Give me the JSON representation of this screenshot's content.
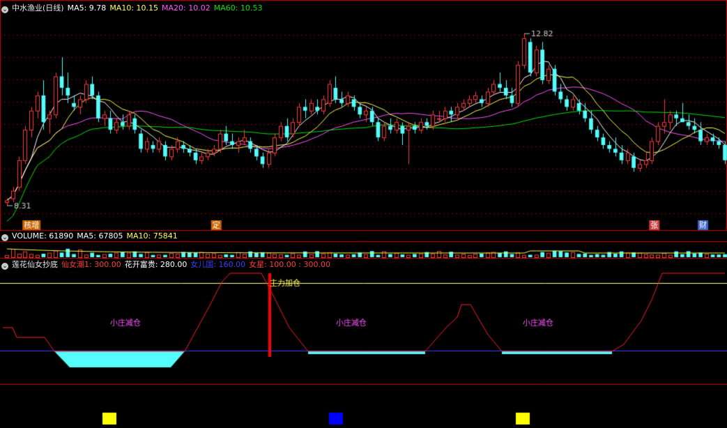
{
  "colors": {
    "up": "#ff3c3c",
    "down": "#54fcfc",
    "ma5": "#ffffff",
    "ma10": "#ffff54",
    "ma20": "#ff54ff",
    "ma60": "#00e600",
    "frame": "#c80000",
    "curve": "#ff2020",
    "blueline": "#3c3cff",
    "yellowline": "#ffffa0",
    "zone_label": "#ff54ff",
    "fill": "#54fcfc"
  },
  "price_panel": {
    "collapse_icon": "⌄",
    "stock_name": "中水渔业(日线)",
    "ma5": "MA5: 9.78",
    "ma10": "MA10: 10.15",
    "ma20": "MA20: 10.02",
    "ma60": "MA60: 10.53",
    "high_label": "12.82",
    "low_label": "8.31",
    "markers": [
      {
        "text": "核增",
        "bg": "#c86400",
        "index": 3
      },
      {
        "text": "定",
        "bg": "#c86400",
        "index": 34
      },
      {
        "text": "张",
        "bg": "#c83c3c",
        "index": 106
      },
      {
        "text": "财",
        "bg": "#3c64c8",
        "index": 114
      }
    ]
  },
  "volume_panel": {
    "collapse_icon": "⌄",
    "label": "VOLUME: 61890",
    "ma5": "MA5: 67805",
    "ma10": "MA10: 75841"
  },
  "indicator_panel": {
    "collapse_icon": "⌄",
    "name": "莲花仙女抄底",
    "v1": "仙女潮1: 300.00",
    "v2": "花开富贵: 280.00",
    "v3": "女儿国: 160.00",
    "v4": "女星: 100.00 : 300.00",
    "signal_label": "主力加仓",
    "zone_labels": [
      "小庄减仓",
      "小庄减仓",
      "小庄减仓"
    ],
    "squares": [
      "#ffff00",
      "#0000ff",
      "#ffff00"
    ]
  },
  "chart_data": {
    "type": "candlestick",
    "price_range": [
      8.0,
      13.3
    ],
    "candles": [
      [
        8.4,
        8.5,
        8.31,
        8.45
      ],
      [
        8.5,
        8.8,
        8.4,
        8.7
      ],
      [
        8.8,
        9.6,
        8.7,
        9.5
      ],
      [
        9.5,
        10.4,
        9.4,
        10.3
      ],
      [
        10.3,
        10.9,
        10.1,
        10.8
      ],
      [
        10.8,
        11.3,
        10.6,
        11.2
      ],
      [
        11.2,
        11.6,
        10.3,
        10.5
      ],
      [
        10.6,
        10.8,
        10.2,
        10.7
      ],
      [
        10.7,
        11.8,
        10.6,
        11.7
      ],
      [
        11.7,
        12.2,
        11.2,
        11.4
      ],
      [
        11.4,
        11.8,
        11.0,
        11.2
      ],
      [
        11.0,
        11.2,
        10.8,
        10.9
      ],
      [
        10.9,
        11.2,
        10.7,
        11.1
      ],
      [
        11.1,
        11.6,
        11.0,
        11.5
      ],
      [
        11.5,
        11.7,
        11.1,
        11.2
      ],
      [
        11.2,
        11.3,
        10.5,
        10.6
      ],
      [
        10.6,
        10.8,
        10.4,
        10.7
      ],
      [
        10.6,
        10.8,
        10.2,
        10.3
      ],
      [
        10.3,
        10.6,
        10.2,
        10.5
      ],
      [
        10.5,
        10.7,
        10.3,
        10.4
      ],
      [
        10.4,
        10.8,
        10.3,
        10.7
      ],
      [
        10.6,
        10.7,
        10.2,
        10.3
      ],
      [
        10.2,
        10.3,
        9.7,
        9.8
      ],
      [
        9.8,
        10.1,
        9.7,
        10.0
      ],
      [
        9.9,
        10.0,
        9.7,
        9.8
      ],
      [
        9.8,
        10.1,
        9.7,
        10.0
      ],
      [
        9.9,
        10.0,
        9.5,
        9.6
      ],
      [
        9.6,
        9.9,
        9.5,
        9.8
      ],
      [
        9.8,
        10.1,
        9.7,
        10.0
      ],
      [
        9.9,
        10.0,
        9.7,
        9.8
      ],
      [
        9.8,
        9.9,
        9.6,
        9.7
      ],
      [
        9.7,
        9.8,
        9.4,
        9.5
      ],
      [
        9.5,
        9.7,
        9.4,
        9.6
      ],
      [
        9.6,
        9.8,
        9.5,
        9.7
      ],
      [
        9.7,
        9.9,
        9.6,
        9.8
      ],
      [
        9.8,
        10.3,
        9.7,
        10.2
      ],
      [
        10.2,
        10.4,
        9.9,
        10.0
      ],
      [
        10.0,
        10.2,
        9.8,
        9.9
      ],
      [
        9.9,
        10.1,
        9.7,
        10.0
      ],
      [
        10.0,
        10.3,
        9.9,
        10.1
      ],
      [
        10.0,
        10.1,
        9.7,
        9.8
      ],
      [
        9.8,
        9.9,
        9.5,
        9.6
      ],
      [
        9.6,
        9.7,
        9.3,
        9.4
      ],
      [
        9.4,
        9.8,
        9.3,
        9.7
      ],
      [
        9.7,
        10.2,
        9.6,
        10.1
      ],
      [
        10.1,
        10.5,
        10.0,
        10.4
      ],
      [
        10.4,
        10.6,
        10.0,
        10.1
      ],
      [
        10.2,
        10.6,
        10.1,
        10.5
      ],
      [
        10.5,
        11.0,
        10.4,
        10.9
      ],
      [
        10.9,
        11.1,
        10.6,
        10.8
      ],
      [
        10.8,
        11.1,
        10.7,
        11.0
      ],
      [
        10.9,
        11.1,
        10.7,
        10.8
      ],
      [
        10.8,
        11.2,
        10.7,
        11.1
      ],
      [
        11.0,
        11.6,
        10.9,
        11.5
      ],
      [
        11.4,
        11.7,
        11.0,
        11.1
      ],
      [
        11.1,
        11.3,
        10.9,
        11.0
      ],
      [
        11.0,
        11.3,
        10.9,
        11.2
      ],
      [
        11.1,
        11.2,
        10.8,
        10.9
      ],
      [
        10.9,
        11.0,
        10.6,
        10.7
      ],
      [
        10.7,
        10.9,
        10.5,
        10.8
      ],
      [
        10.8,
        10.9,
        10.4,
        10.5
      ],
      [
        10.5,
        10.6,
        10.0,
        10.1
      ],
      [
        10.1,
        10.5,
        10.0,
        10.4
      ],
      [
        10.4,
        10.6,
        10.2,
        10.3
      ],
      [
        10.3,
        10.6,
        10.2,
        10.5
      ],
      [
        10.4,
        10.5,
        9.9,
        10.2
      ],
      [
        10.3,
        10.5,
        9.4,
        10.4
      ],
      [
        10.4,
        10.5,
        10.2,
        10.3
      ],
      [
        10.3,
        10.6,
        10.2,
        10.5
      ],
      [
        10.5,
        10.6,
        10.3,
        10.4
      ],
      [
        10.4,
        10.8,
        10.3,
        10.7
      ],
      [
        10.6,
        10.8,
        10.5,
        10.6
      ],
      [
        10.6,
        10.9,
        10.5,
        10.8
      ],
      [
        10.8,
        10.9,
        10.5,
        10.7
      ],
      [
        10.7,
        11.0,
        10.6,
        10.9
      ],
      [
        10.9,
        11.1,
        10.8,
        11.0
      ],
      [
        11.0,
        11.2,
        10.9,
        11.1
      ],
      [
        11.1,
        11.3,
        11.0,
        11.2
      ],
      [
        11.1,
        11.2,
        10.9,
        11.0
      ],
      [
        11.0,
        11.4,
        10.9,
        11.3
      ],
      [
        11.3,
        11.6,
        11.2,
        11.5
      ],
      [
        11.5,
        11.8,
        11.3,
        11.4
      ],
      [
        11.4,
        11.6,
        11.1,
        11.2
      ],
      [
        11.2,
        11.4,
        10.9,
        11.0
      ],
      [
        11.0,
        12.1,
        10.9,
        12.0
      ],
      [
        12.0,
        12.82,
        11.9,
        12.7
      ],
      [
        12.6,
        12.7,
        11.7,
        11.8
      ],
      [
        11.8,
        12.5,
        11.7,
        12.4
      ],
      [
        12.4,
        12.6,
        11.5,
        11.6
      ],
      [
        11.6,
        12.0,
        11.5,
        11.9
      ],
      [
        11.9,
        12.0,
        11.2,
        11.3
      ],
      [
        11.3,
        11.5,
        11.0,
        11.1
      ],
      [
        11.1,
        11.2,
        10.8,
        10.9
      ],
      [
        10.9,
        11.2,
        10.8,
        11.1
      ],
      [
        11.0,
        11.1,
        10.7,
        10.8
      ],
      [
        10.8,
        11.0,
        10.5,
        10.6
      ],
      [
        10.6,
        10.8,
        10.2,
        10.3
      ],
      [
        10.3,
        10.4,
        10.0,
        10.1
      ],
      [
        10.1,
        10.2,
        9.8,
        9.9
      ],
      [
        9.9,
        10.0,
        9.7,
        9.8
      ],
      [
        9.8,
        10.1,
        9.6,
        9.7
      ],
      [
        9.7,
        9.9,
        9.4,
        9.5
      ],
      [
        9.5,
        9.8,
        9.4,
        9.7
      ],
      [
        9.6,
        9.7,
        9.2,
        9.3
      ],
      [
        9.3,
        9.5,
        9.2,
        9.4
      ],
      [
        9.4,
        9.7,
        9.3,
        9.5
      ],
      [
        9.5,
        10.1,
        9.4,
        10.0
      ],
      [
        10.0,
        10.5,
        9.9,
        10.4
      ],
      [
        10.4,
        11.1,
        10.2,
        10.5
      ],
      [
        10.5,
        10.8,
        10.3,
        10.7
      ],
      [
        10.7,
        10.8,
        10.4,
        10.6
      ],
      [
        10.6,
        11.0,
        10.5,
        10.5
      ],
      [
        10.5,
        10.7,
        10.3,
        10.4
      ],
      [
        10.4,
        10.6,
        10.2,
        10.3
      ],
      [
        10.3,
        10.5,
        9.9,
        10.0
      ],
      [
        10.0,
        10.2,
        9.9,
        10.1
      ],
      [
        10.1,
        10.2,
        9.9,
        10.0
      ],
      [
        10.0,
        10.1,
        9.8,
        9.9
      ],
      [
        9.9,
        10.0,
        9.4,
        9.5
      ]
    ]
  }
}
